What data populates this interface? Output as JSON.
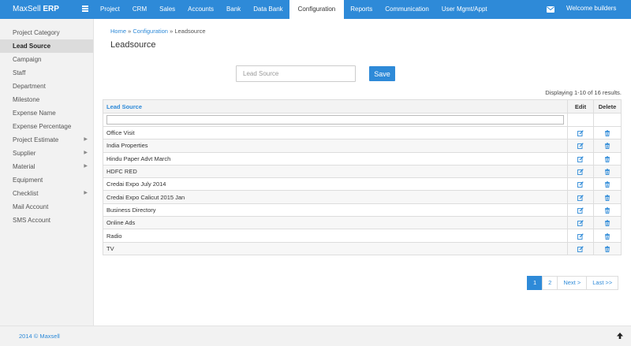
{
  "brand": {
    "name": "MaxSell",
    "suffix": "ERP"
  },
  "nav": {
    "items": [
      "Project",
      "CRM",
      "Sales",
      "Accounts",
      "Bank",
      "Data Bank",
      "Configuration",
      "Reports",
      "Communication",
      "User Mgmt/Appt"
    ],
    "active": "Configuration",
    "welcome": "Welcome builders"
  },
  "sidebar": {
    "items": [
      {
        "label": "Project Category",
        "caret": false
      },
      {
        "label": "Lead Source",
        "caret": false,
        "active": true
      },
      {
        "label": "Campaign",
        "caret": false
      },
      {
        "label": "Staff",
        "caret": false
      },
      {
        "label": "Department",
        "caret": false
      },
      {
        "label": "Milestone",
        "caret": false
      },
      {
        "label": "Expense Name",
        "caret": false
      },
      {
        "label": "Expense Percentage",
        "caret": false
      },
      {
        "label": "Project Estimate",
        "caret": true
      },
      {
        "label": "Supplier",
        "caret": true
      },
      {
        "label": "Material",
        "caret": true
      },
      {
        "label": "Equipment",
        "caret": false
      },
      {
        "label": "Checklist",
        "caret": true
      },
      {
        "label": "Mail Account",
        "caret": false
      },
      {
        "label": "SMS Account",
        "caret": false
      }
    ]
  },
  "breadcrumb": {
    "home": "Home",
    "sep1": " » ",
    "section": "Configuration",
    "sep2": " » ",
    "current": "Leadsource"
  },
  "page": {
    "title": "Leadsource"
  },
  "form": {
    "placeholder": "Lead Source",
    "value": "",
    "save_label": "Save"
  },
  "summary": "Displaying 1-10 of 16 results.",
  "table": {
    "headers": {
      "name": "Lead Source",
      "edit": "Edit",
      "delete": "Delete"
    },
    "rows": [
      "Office Visit",
      "India Properties",
      "Hindu Paper Advt March",
      "HDFC RED",
      "Credai Expo July 2014",
      "Credai Expo Calicut 2015 Jan",
      "Business Directory",
      "Online Ads",
      "Radio",
      "TV"
    ]
  },
  "pagination": {
    "pages": [
      "1",
      "2"
    ],
    "active": "1",
    "next": "Next >",
    "last": "Last >>"
  },
  "footer": {
    "text": "2014 © Maxsell"
  },
  "colors": {
    "primary": "#2e8ad8",
    "sidebar_bg": "#f2f2f2",
    "active_item_bg": "#dcdcdc"
  },
  "icons": {
    "menu": "hamburger-icon",
    "mail": "envelope-icon",
    "edit": "edit-icon",
    "delete": "trash-icon",
    "scroll_top": "arrow-up-icon"
  }
}
